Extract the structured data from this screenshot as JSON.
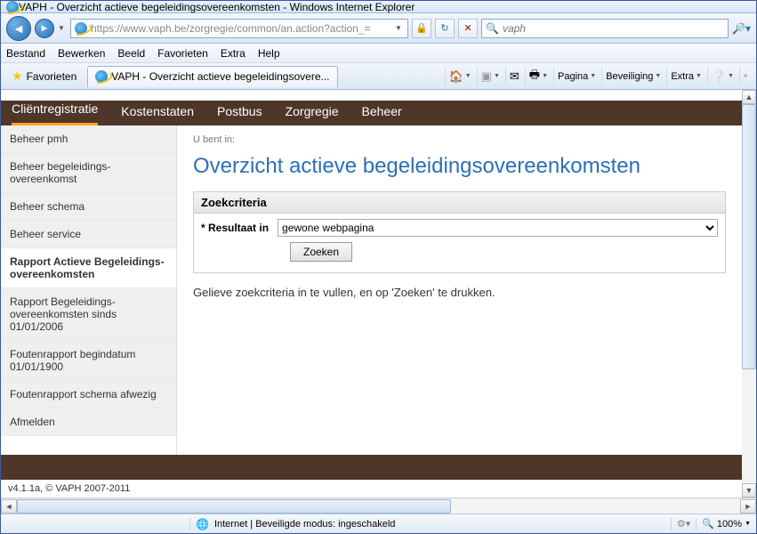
{
  "window": {
    "title": "VAPH - Overzicht actieve begeleidingsovereenkomsten - Windows Internet Explorer"
  },
  "address": {
    "url_display": "https://www.vaph.be/zorgregie/common/an.action?action_="
  },
  "search": {
    "placeholder": "vaph"
  },
  "ie_menu": [
    "Bestand",
    "Bewerken",
    "Beeld",
    "Favorieten",
    "Extra",
    "Help"
  ],
  "favorites_label": "Favorieten",
  "tab": {
    "title": "VAPH - Overzicht actieve begeleidingsovere..."
  },
  "command_bar": {
    "pagina": "Pagina",
    "beveiliging": "Beveiliging",
    "extra": "Extra"
  },
  "app_nav": [
    {
      "label": "Cliëntregistratie",
      "active": true
    },
    {
      "label": "Kostenstaten"
    },
    {
      "label": "Postbus"
    },
    {
      "label": "Zorgregie"
    },
    {
      "label": "Beheer"
    }
  ],
  "sidebar": {
    "items": [
      "Beheer pmh",
      "Beheer begeleidings-overeenkomst",
      "Beheer schema",
      "Beheer service",
      "Rapport Actieve Begeleidings-overeenkomsten",
      "Rapport Begeleidings-overeenkomsten sinds 01/01/2006",
      "Foutenrapport begindatum 01/01/1900",
      "Foutenrapport schema afwezig",
      "Afmelden"
    ],
    "active_index": 4
  },
  "content": {
    "breadcrumb": "U bent in:",
    "title": "Overzicht actieve begeleidingsovereenkomsten",
    "panel_title": "Zoekcriteria",
    "result_label": "* Resultaat in",
    "result_value": "gewone webpagina",
    "search_button": "Zoeken",
    "instruction": "Gelieve zoekcriteria in te vullen, en op 'Zoeken' te drukken."
  },
  "footer_version": "v4.1.1a, © VAPH 2007-2011",
  "status": {
    "security": "Internet | Beveiligde modus: ingeschakeld",
    "zoom": "100%"
  }
}
